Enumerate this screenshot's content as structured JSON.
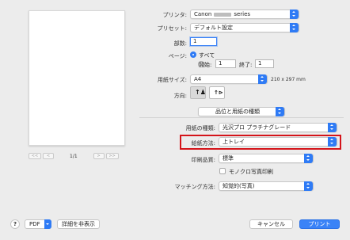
{
  "preview": {
    "page_count": "1/1",
    "first_label": "<<",
    "prev_label": "<",
    "next_label": ">",
    "last_label": ">>"
  },
  "printer": {
    "label": "プリンタ:",
    "value_prefix": "Canon",
    "value_suffix": "series"
  },
  "presets": {
    "label": "プリセット:",
    "value": "デフォルト設定"
  },
  "copies": {
    "label": "部数:",
    "value": "1"
  },
  "pages": {
    "label": "ページ:",
    "all_label": "すべて",
    "all_selected": true,
    "from_label": "開始:",
    "from_value": "1",
    "to_label": "終了:",
    "to_value": "1"
  },
  "paper_size": {
    "label": "用紙サイズ:",
    "value": "A4",
    "dimensions": "210 x 297 mm"
  },
  "orientation": {
    "label": "方向:",
    "selected": "portrait"
  },
  "section_popup": {
    "value": "品位と用紙の種類"
  },
  "media_type": {
    "label": "用紙の種類:",
    "value": "光沢プロ プラチナグレード"
  },
  "paper_source": {
    "label": "給紙方法:",
    "value": "上トレイ"
  },
  "print_quality": {
    "label": "印刷品質:",
    "value": "標準"
  },
  "grayscale": {
    "label": "モノクロ写真印刷",
    "checked": false
  },
  "color_matching": {
    "label": "マッチング方法:",
    "value": "知覚的(写真)"
  },
  "footer": {
    "help_label": "?",
    "pdf_label": "PDF",
    "hide_details_label": "詳細を非表示",
    "cancel_label": "キャンセル",
    "print_label": "プリント"
  },
  "colors": {
    "accent": "#2f7bf5",
    "highlight": "#d4141a"
  }
}
